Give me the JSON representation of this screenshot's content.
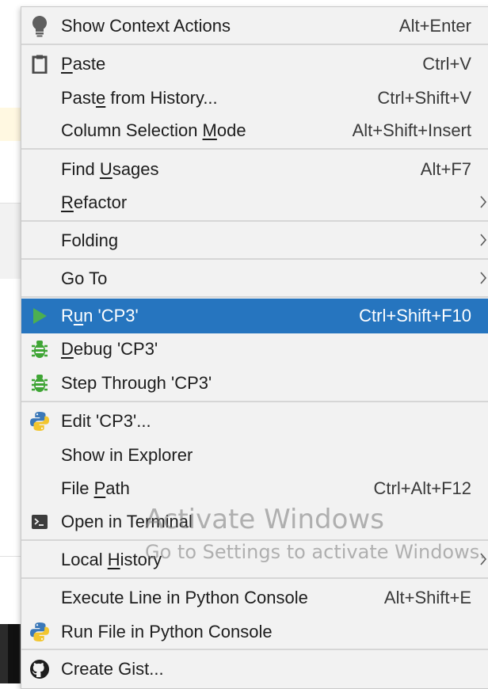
{
  "menu": {
    "items": [
      {
        "id": "show-context-actions",
        "pre": "Show Context Actions",
        "u": "",
        "post": "",
        "shortcut": "Alt+Enter",
        "icon": "lightbulb-icon"
      },
      {
        "id": "paste",
        "pre": "",
        "u": "P",
        "post": "aste",
        "shortcut": "Ctrl+V",
        "icon": "clipboard-icon"
      },
      {
        "id": "paste-from-history",
        "pre": "Past",
        "u": "e",
        "post": " from History...",
        "shortcut": "Ctrl+Shift+V",
        "icon": ""
      },
      {
        "id": "column-selection-mode",
        "pre": "Column Selection ",
        "u": "M",
        "post": "ode",
        "shortcut": "Alt+Shift+Insert",
        "icon": ""
      },
      {
        "id": "find-usages",
        "pre": "Find ",
        "u": "U",
        "post": "sages",
        "shortcut": "Alt+F7",
        "icon": ""
      },
      {
        "id": "refactor",
        "pre": "",
        "u": "R",
        "post": "efactor",
        "shortcut": "",
        "icon": "",
        "submenu": true
      },
      {
        "id": "folding",
        "pre": "Folding",
        "u": "",
        "post": "",
        "shortcut": "",
        "icon": "",
        "submenu": true
      },
      {
        "id": "go-to",
        "pre": "Go To",
        "u": "",
        "post": "",
        "shortcut": "",
        "icon": "",
        "submenu": true
      },
      {
        "id": "run-cp3",
        "pre": "R",
        "u": "u",
        "post": "n 'CP3'",
        "shortcut": "Ctrl+Shift+F10",
        "icon": "run-icon",
        "selected": true
      },
      {
        "id": "debug-cp3",
        "pre": "",
        "u": "D",
        "post": "ebug 'CP3'",
        "shortcut": "",
        "icon": "bug-icon"
      },
      {
        "id": "step-through-cp3",
        "pre": "Step Through 'CP3'",
        "u": "",
        "post": "",
        "shortcut": "",
        "icon": "bug-icon"
      },
      {
        "id": "edit-cp3",
        "pre": "Edit 'CP3'...",
        "u": "",
        "post": "",
        "shortcut": "",
        "icon": "python-icon"
      },
      {
        "id": "show-in-explorer",
        "pre": "Show in Explorer",
        "u": "",
        "post": "",
        "shortcut": "",
        "icon": ""
      },
      {
        "id": "file-path",
        "pre": "File ",
        "u": "P",
        "post": "ath",
        "shortcut": "Ctrl+Alt+F12",
        "icon": ""
      },
      {
        "id": "open-in-terminal",
        "pre": "Open in Terminal",
        "u": "",
        "post": "",
        "shortcut": "",
        "icon": "terminal-icon"
      },
      {
        "id": "local-history",
        "pre": "Local ",
        "u": "H",
        "post": "istory",
        "shortcut": "",
        "icon": "",
        "submenu": true
      },
      {
        "id": "execute-line-python-console",
        "pre": "Execute Line in Python Console",
        "u": "",
        "post": "",
        "shortcut": "Alt+Shift+E",
        "icon": ""
      },
      {
        "id": "run-file-python-console",
        "pre": "Run File in Python Console",
        "u": "",
        "post": "",
        "shortcut": "",
        "icon": "python-icon"
      },
      {
        "id": "create-gist",
        "pre": "Create Gist...",
        "u": "",
        "post": "",
        "shortcut": "",
        "icon": "github-icon"
      }
    ]
  },
  "watermark": {
    "title": "Activate Windows",
    "subtitle": "Go to Settings to activate Windows."
  },
  "colors": {
    "menu_bg": "#f2f2f2",
    "selection": "#2675bf",
    "separator": "#d6d6d6",
    "run_green": "#4caf50",
    "bug_green": "#3fa535"
  }
}
